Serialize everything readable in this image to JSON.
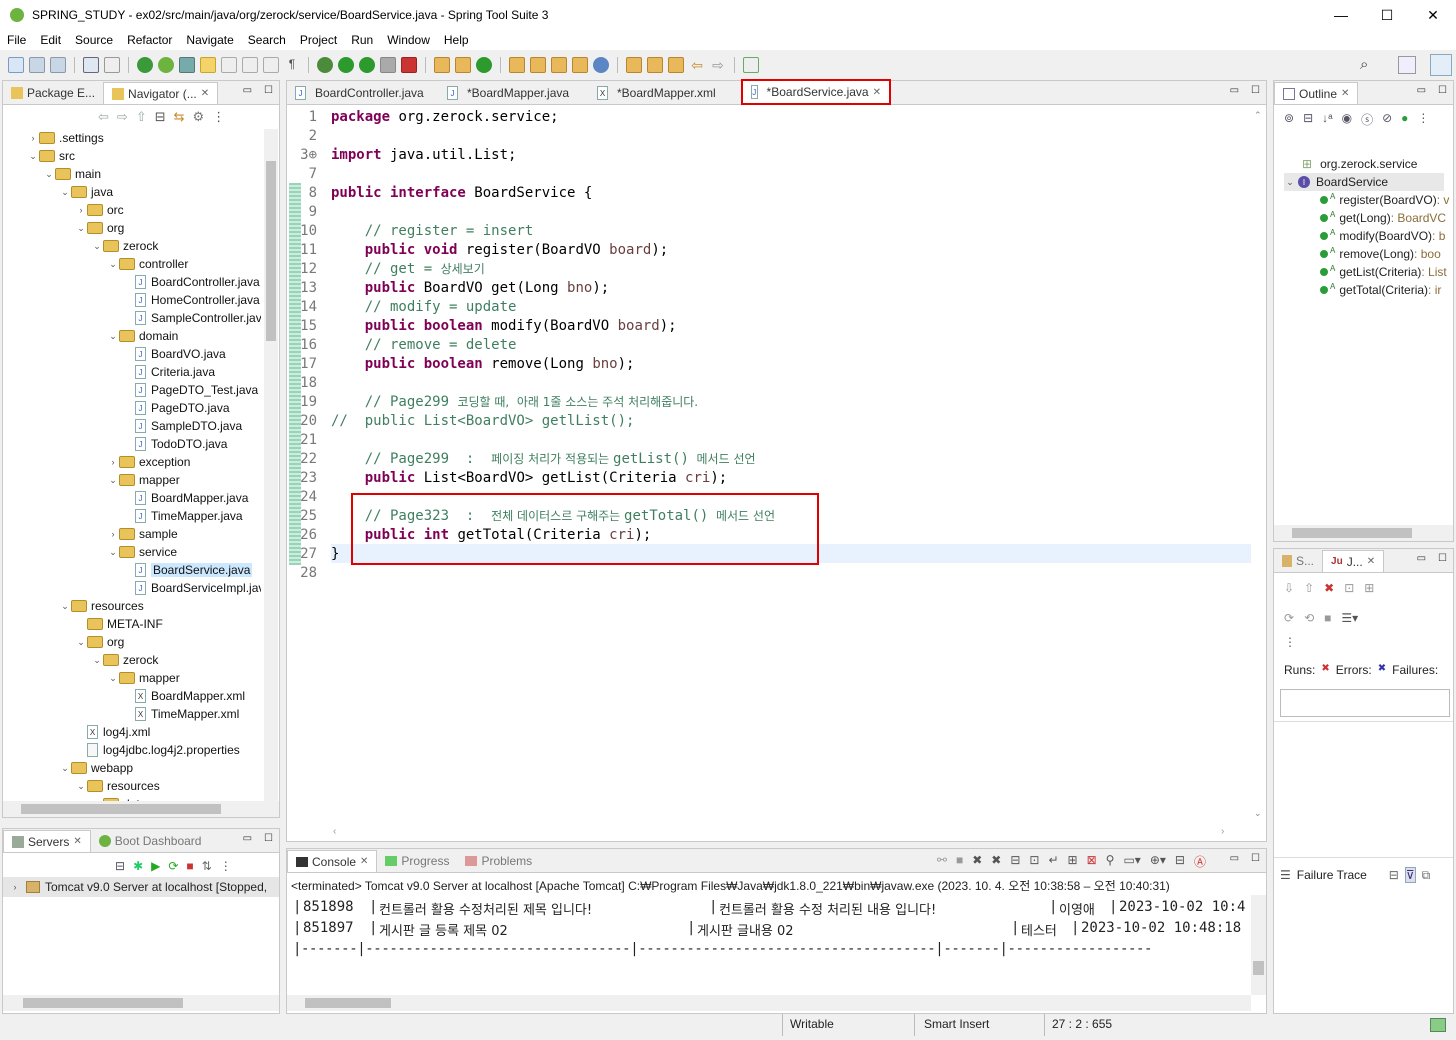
{
  "window": {
    "title": "SPRING_STUDY - ex02/src/main/java/org/zerock/service/BoardService.java - Spring Tool Suite 3",
    "controls": [
      "—",
      "☐",
      "✕"
    ]
  },
  "menu": [
    "File",
    "Edit",
    "Source",
    "Refactor",
    "Navigate",
    "Search",
    "Project",
    "Run",
    "Window",
    "Help"
  ],
  "explorer": {
    "tabs": [
      {
        "label": "Package E...",
        "active": false
      },
      {
        "label": "Navigator (...",
        "active": true
      }
    ],
    "tree": [
      {
        "label": ".settings",
        "depth": 1,
        "type": "folder",
        "toggle": "›"
      },
      {
        "label": "src",
        "depth": 1,
        "type": "folder",
        "toggle": "⌄"
      },
      {
        "label": "main",
        "depth": 2,
        "type": "folder",
        "toggle": "⌄"
      },
      {
        "label": "java",
        "depth": 3,
        "type": "folder",
        "toggle": "⌄"
      },
      {
        "label": "orc",
        "depth": 4,
        "type": "folder",
        "toggle": "›"
      },
      {
        "label": "org",
        "depth": 4,
        "type": "folder",
        "toggle": "⌄"
      },
      {
        "label": "zerock",
        "depth": 5,
        "type": "folder",
        "toggle": "⌄"
      },
      {
        "label": "controller",
        "depth": 6,
        "type": "folder",
        "toggle": "⌄"
      },
      {
        "label": "BoardController.java",
        "depth": 7,
        "type": "java",
        "toggle": ""
      },
      {
        "label": "HomeController.java",
        "depth": 7,
        "type": "java",
        "toggle": ""
      },
      {
        "label": "SampleController.java",
        "depth": 7,
        "type": "java",
        "toggle": ""
      },
      {
        "label": "domain",
        "depth": 6,
        "type": "folder",
        "toggle": "⌄"
      },
      {
        "label": "BoardVO.java",
        "depth": 7,
        "type": "java",
        "toggle": ""
      },
      {
        "label": "Criteria.java",
        "depth": 7,
        "type": "java",
        "toggle": ""
      },
      {
        "label": "PageDTO_Test.java",
        "depth": 7,
        "type": "java",
        "toggle": ""
      },
      {
        "label": "PageDTO.java",
        "depth": 7,
        "type": "java",
        "toggle": ""
      },
      {
        "label": "SampleDTO.java",
        "depth": 7,
        "type": "java",
        "toggle": ""
      },
      {
        "label": "TodoDTO.java",
        "depth": 7,
        "type": "java",
        "toggle": ""
      },
      {
        "label": "exception",
        "depth": 6,
        "type": "folder",
        "toggle": "›"
      },
      {
        "label": "mapper",
        "depth": 6,
        "type": "folder",
        "toggle": "⌄"
      },
      {
        "label": "BoardMapper.java",
        "depth": 7,
        "type": "java",
        "toggle": ""
      },
      {
        "label": "TimeMapper.java",
        "depth": 7,
        "type": "java",
        "toggle": ""
      },
      {
        "label": "sample",
        "depth": 6,
        "type": "folder",
        "toggle": "›"
      },
      {
        "label": "service",
        "depth": 6,
        "type": "folder",
        "toggle": "⌄"
      },
      {
        "label": "BoardService.java",
        "depth": 7,
        "type": "java",
        "toggle": "",
        "selected": true
      },
      {
        "label": "BoardServiceImpl.java",
        "depth": 7,
        "type": "java",
        "toggle": ""
      },
      {
        "label": "resources",
        "depth": 3,
        "type": "folder",
        "toggle": "⌄"
      },
      {
        "label": "META-INF",
        "depth": 4,
        "type": "folder",
        "toggle": ""
      },
      {
        "label": "org",
        "depth": 4,
        "type": "folder",
        "toggle": "⌄"
      },
      {
        "label": "zerock",
        "depth": 5,
        "type": "folder",
        "toggle": "⌄"
      },
      {
        "label": "mapper",
        "depth": 6,
        "type": "folder",
        "toggle": "⌄"
      },
      {
        "label": "BoardMapper.xml",
        "depth": 7,
        "type": "xml",
        "toggle": ""
      },
      {
        "label": "TimeMapper.xml",
        "depth": 7,
        "type": "xml",
        "toggle": ""
      },
      {
        "label": "log4j.xml",
        "depth": 4,
        "type": "xml",
        "toggle": ""
      },
      {
        "label": "log4jdbc.log4j2.properties",
        "depth": 4,
        "type": "prop",
        "toggle": ""
      },
      {
        "label": "webapp",
        "depth": 3,
        "type": "folder",
        "toggle": "⌄"
      },
      {
        "label": "resources",
        "depth": 4,
        "type": "folder",
        "toggle": "⌄"
      },
      {
        "label": "data",
        "depth": 5,
        "type": "folder",
        "toggle": "⌄"
      }
    ]
  },
  "editor": {
    "tabs": [
      {
        "label": "BoardController.java",
        "active": false,
        "icon": "J"
      },
      {
        "label": "*BoardMapper.java",
        "active": false,
        "icon": "J"
      },
      {
        "label": "*BoardMapper.xml",
        "active": false,
        "icon": "X"
      },
      {
        "label": "*BoardService.java",
        "active": true,
        "icon": "J"
      }
    ],
    "lines": [
      {
        "n": "1",
        "html": [
          [
            "kw",
            "package"
          ],
          [
            "plain",
            " org.zerock.service;"
          ]
        ]
      },
      {
        "n": "2",
        "html": []
      },
      {
        "n": "3⊕",
        "html": [
          [
            "kw",
            "import"
          ],
          [
            "plain",
            " java.util.List;"
          ]
        ]
      },
      {
        "n": "7",
        "html": []
      },
      {
        "n": "8",
        "html": [
          [
            "kw",
            "public interface"
          ],
          [
            "plain",
            " BoardService "
          ],
          [
            "plain",
            "{"
          ]
        ]
      },
      {
        "n": "9",
        "html": []
      },
      {
        "n": "10",
        "html": [
          [
            "plain",
            "    "
          ],
          [
            "cm",
            "// register = insert"
          ]
        ]
      },
      {
        "n": "11",
        "html": [
          [
            "plain",
            "    "
          ],
          [
            "kw",
            "public void"
          ],
          [
            "plain",
            " register(BoardVO "
          ],
          [
            "pm",
            "board"
          ],
          [
            "plain",
            ");"
          ]
        ]
      },
      {
        "n": "12",
        "html": [
          [
            "plain",
            "    "
          ],
          [
            "cm",
            "// get = "
          ],
          [
            "cmkr",
            "상세보기"
          ]
        ]
      },
      {
        "n": "13",
        "html": [
          [
            "plain",
            "    "
          ],
          [
            "kw",
            "public"
          ],
          [
            "plain",
            " BoardVO get(Long "
          ],
          [
            "pm",
            "bno"
          ],
          [
            "plain",
            ");"
          ]
        ]
      },
      {
        "n": "14",
        "html": [
          [
            "plain",
            "    "
          ],
          [
            "cm",
            "// modify = update"
          ]
        ]
      },
      {
        "n": "15",
        "html": [
          [
            "plain",
            "    "
          ],
          [
            "kw",
            "public boolean"
          ],
          [
            "plain",
            " modify(BoardVO "
          ],
          [
            "pm",
            "board"
          ],
          [
            "plain",
            ");"
          ]
        ]
      },
      {
        "n": "16",
        "html": [
          [
            "plain",
            "    "
          ],
          [
            "cm",
            "// remove = delete"
          ]
        ]
      },
      {
        "n": "17",
        "html": [
          [
            "plain",
            "    "
          ],
          [
            "kw",
            "public boolean"
          ],
          [
            "plain",
            " remove(Long "
          ],
          [
            "pm",
            "bno"
          ],
          [
            "plain",
            ");"
          ]
        ]
      },
      {
        "n": "18",
        "html": []
      },
      {
        "n": "19",
        "html": [
          [
            "plain",
            "    "
          ],
          [
            "cm",
            "// Page299 "
          ],
          [
            "cmkr",
            "코딩할 때,  아래 1줄 소스는 주석 처리해줍니다."
          ]
        ]
      },
      {
        "n": "20",
        "html": [
          [
            "cm",
            "//  public List<BoardVO> getlList();"
          ]
        ]
      },
      {
        "n": "21",
        "html": []
      },
      {
        "n": "22",
        "html": [
          [
            "plain",
            "    "
          ],
          [
            "cm",
            "// Page299  :  "
          ],
          [
            "cmkr",
            "페이징 처리가 적용되는 "
          ],
          [
            "cm",
            "getList()"
          ],
          [
            "cmkr",
            "  메서드 선언"
          ]
        ]
      },
      {
        "n": "23",
        "html": [
          [
            "plain",
            "    "
          ],
          [
            "kw",
            "public"
          ],
          [
            "plain",
            " List<BoardVO> getList(Criteria "
          ],
          [
            "pm",
            "cri"
          ],
          [
            "plain",
            ");"
          ]
        ]
      },
      {
        "n": "24",
        "html": []
      },
      {
        "n": "25",
        "html": [
          [
            "plain",
            "    "
          ],
          [
            "cm",
            "// Page323  :  "
          ],
          [
            "cmkr",
            "전체 데이터스르 구해주는 "
          ],
          [
            "cm",
            "getTotal()"
          ],
          [
            "cmkr",
            "  메서드 선언"
          ]
        ]
      },
      {
        "n": "26",
        "html": [
          [
            "plain",
            "    "
          ],
          [
            "kw",
            "public int"
          ],
          [
            "plain",
            " getTotal(Criteria "
          ],
          [
            "pm",
            "cri"
          ],
          [
            "plain",
            ");"
          ]
        ]
      },
      {
        "n": "27",
        "html": [
          [
            "plain",
            "}"
          ]
        ]
      },
      {
        "n": "28",
        "html": []
      }
    ]
  },
  "outline": {
    "tab": "Outline",
    "items": [
      {
        "label": "org.zerock.service",
        "type": "package"
      },
      {
        "label": "BoardService",
        "type": "interface"
      },
      {
        "name": "register(BoardVO)",
        "ret": " : v"
      },
      {
        "name": "get(Long)",
        "ret": " : BoardVC"
      },
      {
        "name": "modify(BoardVO)",
        "ret": " : b"
      },
      {
        "name": "remove(Long)",
        "ret": " : boo"
      },
      {
        "name": "getList(Criteria)",
        "ret": " : List"
      },
      {
        "name": "getTotal(Criteria)",
        "ret": " : ir"
      }
    ]
  },
  "junit": {
    "tabs": [
      "S...",
      "J..."
    ],
    "runs": "Runs:",
    "errors": "Errors:",
    "failures": "Failures:",
    "failure_trace": "Failure Trace"
  },
  "servers": {
    "tabs": [
      "Servers",
      "Boot Dashboard"
    ],
    "item": "Tomcat v9.0 Server at localhost  [Stopped,"
  },
  "console": {
    "tabs": [
      "Console",
      "Progress",
      "Problems"
    ],
    "header": "<terminated> Tomcat v9.0 Server at localhost [Apache Tomcat] C:₩Program Files₩Java₩jdk1.8.0_221₩bin₩javaw.exe  (2023. 10. 4. 오전 10:38:58 – 오전 10:40:31)",
    "rows": [
      {
        "id": "851898",
        "title": "컨트롤러 활용 수정처리된 제목 입니다!",
        "content": "컨트롤러 활용 수정 처리된 내용 입니다!",
        "writer": "이영애",
        "date": "2023-10-02 10:4"
      },
      {
        "id": "851897",
        "title": "게시판 글 등록 제목 02",
        "content": "게시판 글내용 02",
        "writer": "테스터",
        "date": "2023-10-02 10:48:18"
      }
    ],
    "divider": "|-------|---------------------------------|-------------------------------------|-------|------------------"
  },
  "status": {
    "writable": "Writable",
    "insert": "Smart Insert",
    "position": "27 : 2 : 655"
  },
  "colors": {
    "highlight_red": "#e00000",
    "keyword": "#7f0055",
    "comment": "#3f7f5f",
    "param": "#6a3e3e",
    "selection": "#cce8ff",
    "current_line": "#e8f2fe"
  }
}
